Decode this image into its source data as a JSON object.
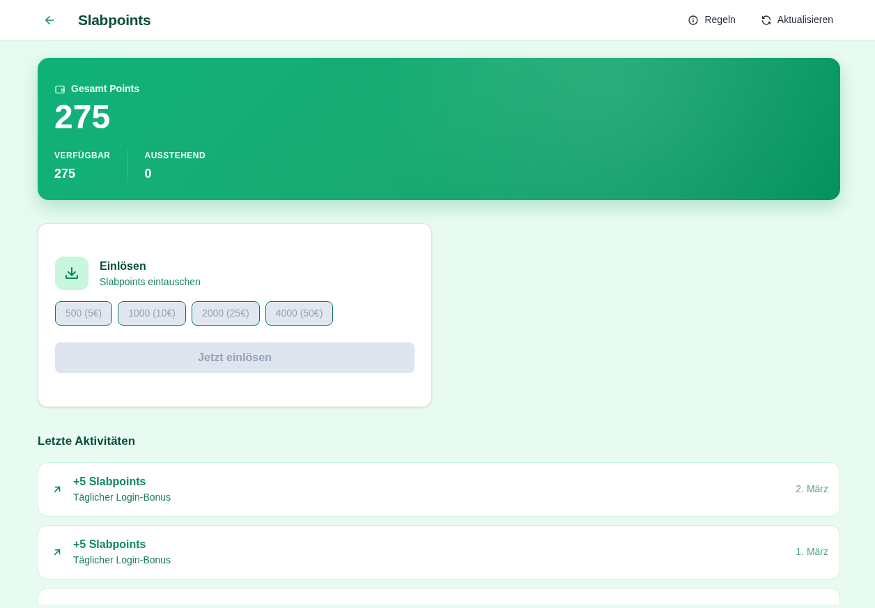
{
  "header": {
    "title": "Slabpoints",
    "actions": [
      {
        "kind": "info",
        "label": "Regeln"
      },
      {
        "kind": "refresh",
        "label": "Aktualisieren"
      }
    ]
  },
  "summary": {
    "label": "Gesamt Points",
    "total": "275",
    "stats": [
      {
        "label": "VERFÜGBAR",
        "value": "275"
      },
      {
        "label": "AUSSTEHEND",
        "value": "0"
      }
    ]
  },
  "redeem": {
    "title": "Einlösen",
    "subtitle": "Slabpoints eintauschen",
    "options": [
      {
        "label": "500 (5€)",
        "disabled": true
      },
      {
        "label": "1000 (10€)",
        "disabled": true
      },
      {
        "label": "2000 (25€)",
        "disabled": true
      },
      {
        "label": "4000 (50€)",
        "disabled": true
      }
    ],
    "button": {
      "label": "Jetzt einlösen",
      "disabled": true
    }
  },
  "activity": {
    "heading": "Letzte Aktivitäten",
    "items": [
      {
        "title": "+5 Slabpoints",
        "description": "Täglicher Login-Bonus",
        "date": "2. März"
      },
      {
        "title": "+5 Slabpoints",
        "description": "Täglicher Login-Bonus",
        "date": "1. März"
      }
    ],
    "more_below": true
  }
}
